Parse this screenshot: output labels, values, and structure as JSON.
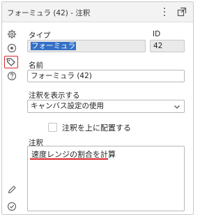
{
  "window": {
    "title": "フォーミュラ (42) - 注釈"
  },
  "sidebar": {
    "items": [
      {
        "name": "configuration",
        "icon": "gear-icon"
      },
      {
        "name": "layout",
        "icon": "target-icon"
      },
      {
        "name": "annotation",
        "icon": "tag-icon",
        "active": true
      },
      {
        "name": "help",
        "icon": "help-icon"
      }
    ],
    "bottom_items": [
      {
        "name": "edit",
        "icon": "pencil-icon"
      },
      {
        "name": "status",
        "icon": "check-circle-icon"
      }
    ],
    "active_highlight_color": "#d9232b"
  },
  "form": {
    "type_label": "タイプ",
    "type_value": "フォーミュラ",
    "id_label": "ID",
    "id_value": "42",
    "name_label": "名前",
    "name_value": "フォーミュラ (42)",
    "show_annotation_label": "注釈を表示する",
    "show_annotation_value": "キャンバス設定の使用",
    "place_on_top_label": "注釈を上に配置する",
    "place_on_top_checked": false,
    "annotation_label": "注釈",
    "annotation_value": "速度レンジの割合を計算"
  },
  "colors": {
    "selection": "#3470c6",
    "underline": "#d9232b"
  }
}
